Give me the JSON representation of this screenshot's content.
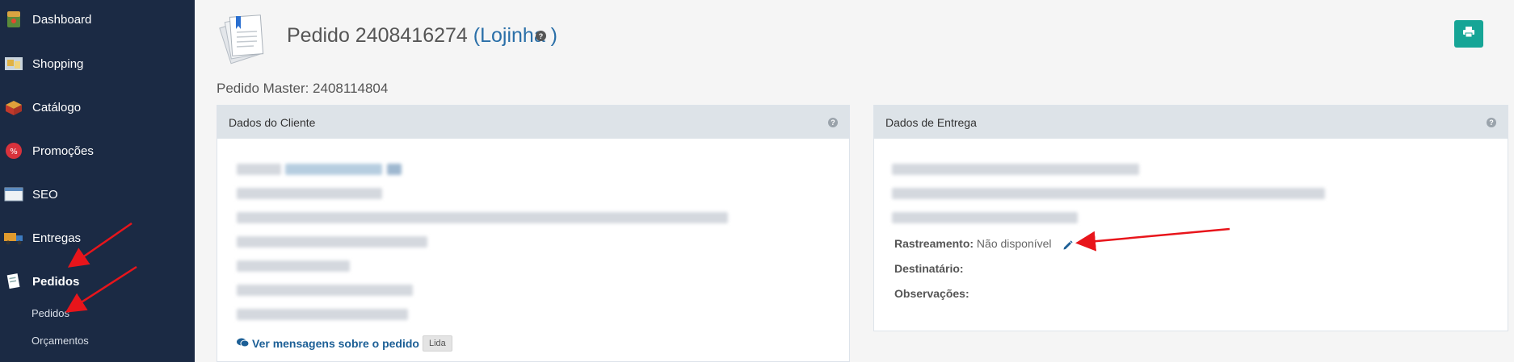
{
  "sidebar": {
    "items": [
      {
        "label": "Dashboard",
        "icon": "dashboard-icon"
      },
      {
        "label": "Shopping",
        "icon": "shopping-icon"
      },
      {
        "label": "Catálogo",
        "icon": "catalog-icon"
      },
      {
        "label": "Promoções",
        "icon": "promotions-icon"
      },
      {
        "label": "SEO",
        "icon": "seo-icon"
      },
      {
        "label": "Entregas",
        "icon": "delivery-truck-icon"
      },
      {
        "label": "Pedidos",
        "icon": "orders-icon"
      }
    ],
    "subitems": [
      {
        "label": "Pedidos"
      },
      {
        "label": "Orçamentos"
      }
    ]
  },
  "header": {
    "title_prefix": "Pedido 2408416274",
    "store": "(Lojinha )",
    "master": "Pedido Master: 2408114804"
  },
  "client_panel": {
    "title": "Dados do Cliente",
    "messages_link": "Ver mensagens sobre o pedido",
    "messages_badge": "Lida"
  },
  "delivery_panel": {
    "title": "Dados de Entrega",
    "tracking_label": "Rastreamento:",
    "tracking_value": "Não disponível",
    "recipient_label": "Destinatário:",
    "notes_label": "Observações:"
  },
  "colors": {
    "sidebar_bg": "#1b2a44",
    "accent": "#16a596",
    "link": "#1c5f96",
    "annotation_arrow": "#e8151b"
  }
}
